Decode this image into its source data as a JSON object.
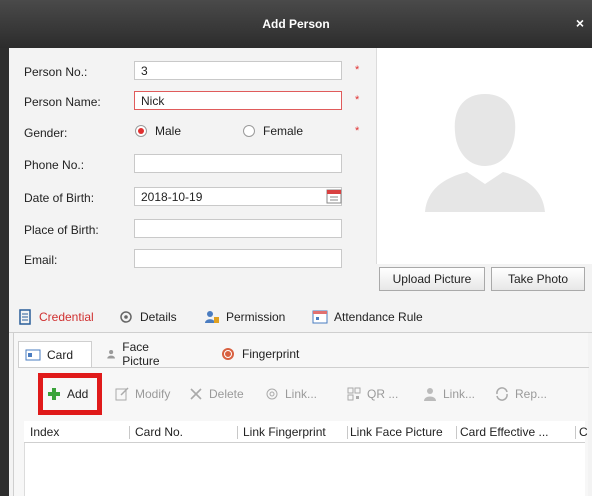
{
  "window": {
    "title": "Add Person",
    "close_glyph": "×"
  },
  "form": {
    "person_no": {
      "label": "Person No.:",
      "value": "3"
    },
    "person_name": {
      "label": "Person Name:",
      "value": "Nick"
    },
    "gender": {
      "label": "Gender:",
      "options": [
        "Male",
        "Female"
      ],
      "selected": "Male"
    },
    "phone": {
      "label": "Phone No.:",
      "value": ""
    },
    "dob": {
      "label": "Date of Birth:",
      "value": "2018-10-19"
    },
    "place_of_birth": {
      "label": "Place of Birth:",
      "value": ""
    },
    "email": {
      "label": "Email:",
      "value": ""
    },
    "required_mark": "*"
  },
  "photo": {
    "upload_label": "Upload Picture",
    "take_label": "Take Photo"
  },
  "tabs": [
    {
      "label": "Credential",
      "icon": "credential-icon",
      "active": true
    },
    {
      "label": "Details",
      "icon": "details-icon",
      "active": false
    },
    {
      "label": "Permission",
      "icon": "permission-icon",
      "active": false
    },
    {
      "label": "Attendance Rule",
      "icon": "attendance-icon",
      "active": false
    }
  ],
  "subtabs": [
    {
      "label": "Card",
      "icon": "card-icon",
      "active": true
    },
    {
      "label": "Face Picture",
      "icon": "face-icon",
      "active": false
    },
    {
      "label": "Fingerprint",
      "icon": "fingerprint-icon",
      "active": false
    }
  ],
  "toolbar": [
    {
      "label": "Add",
      "icon": "plus-icon",
      "enabled": true
    },
    {
      "label": "Modify",
      "icon": "modify-icon",
      "enabled": false
    },
    {
      "label": "Delete",
      "icon": "delete-icon",
      "enabled": false
    },
    {
      "label": "Link...",
      "icon": "link-fingerprint-icon",
      "enabled": false
    },
    {
      "label": "QR ...",
      "icon": "qr-icon",
      "enabled": false
    },
    {
      "label": "Link...",
      "icon": "link-face-icon",
      "enabled": false
    },
    {
      "label": "Rep...",
      "icon": "replace-icon",
      "enabled": false
    }
  ],
  "table": {
    "columns": [
      "Index",
      "Card No.",
      "Link Fingerprint",
      "Link Face Picture",
      "Card Effective ...",
      "C"
    ]
  },
  "colors": {
    "accent": "#d03030",
    "highlight": "#e01a1a",
    "titlebar": "#3a3a3a"
  }
}
